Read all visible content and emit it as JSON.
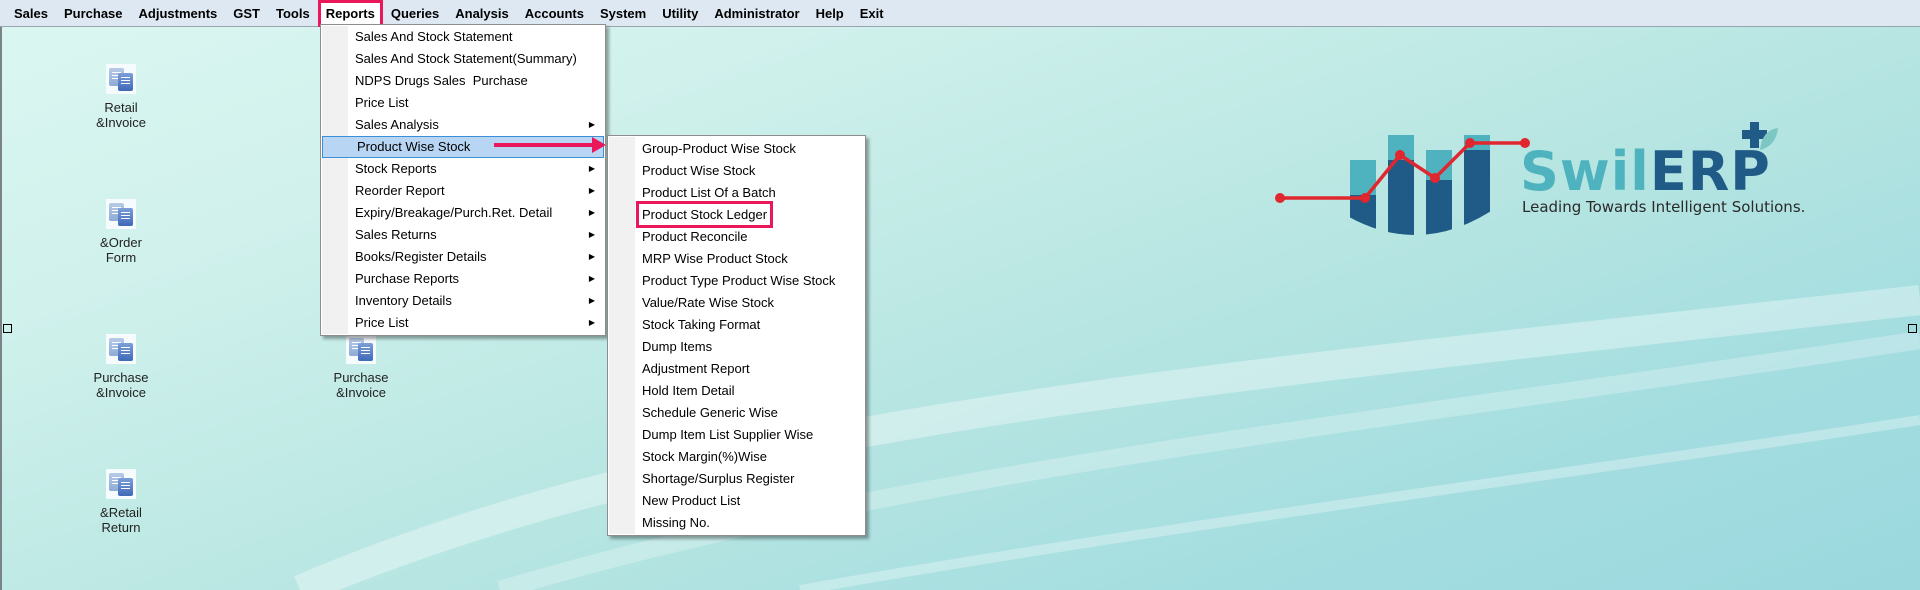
{
  "menubar": {
    "items": [
      "Sales",
      "Purchase",
      "Adjustments",
      "GST",
      "Tools",
      "Reports",
      "Queries",
      "Analysis",
      "Accounts",
      "System",
      "Utility",
      "Administrator",
      "Help",
      "Exit"
    ],
    "active": "Reports"
  },
  "desktop_icons": [
    {
      "line1": "Retail",
      "line2": "&Invoice",
      "icon": "documents-icon"
    },
    {
      "line1": "&Order",
      "line2": "Form",
      "icon": "documents-icon"
    },
    {
      "line1": "Purchase",
      "line2": "&Invoice",
      "icon": "documents-icon"
    },
    {
      "line1": "Purchase",
      "line2": "&Invoice",
      "icon": "documents-icon"
    },
    {
      "line1": "&Retail",
      "line2": "Return",
      "icon": "documents-icon"
    }
  ],
  "reports_menu": {
    "items": [
      {
        "label": "Sales And Stock Statement",
        "submenu": false
      },
      {
        "label": "Sales And Stock Statement(Summary)",
        "submenu": false
      },
      {
        "label": "NDPS Drugs Sales  Purchase",
        "submenu": false
      },
      {
        "label": "Price List",
        "submenu": false
      },
      {
        "label": "Sales Analysis",
        "submenu": true
      },
      {
        "label": "Product Wise Stock",
        "submenu": true,
        "highlighted": true
      },
      {
        "label": "Stock Reports",
        "submenu": true
      },
      {
        "label": "Reorder Report",
        "submenu": true
      },
      {
        "label": "Expiry/Breakage/Purch.Ret. Detail",
        "submenu": true
      },
      {
        "label": "Sales Returns",
        "submenu": true
      },
      {
        "label": "Books/Register Details",
        "submenu": true
      },
      {
        "label": "Purchase Reports",
        "submenu": true
      },
      {
        "label": "Inventory Details",
        "submenu": true
      },
      {
        "label": "Price List",
        "submenu": true
      }
    ]
  },
  "product_wise_stock_submenu": {
    "items": [
      "Group-Product Wise Stock",
      "Product Wise Stock",
      "Product List Of a Batch",
      "Product Stock Ledger",
      "Product Reconcile",
      "MRP Wise Product Stock",
      "Product Type Product Wise Stock",
      "Value/Rate Wise Stock",
      "Stock Taking Format",
      "Dump Items",
      "Adjustment Report",
      "Hold Item Detail",
      "Schedule Generic Wise",
      "Dump Item List Supplier Wise",
      "Stock Margin(%)Wise",
      "Shortage/Surplus Register",
      "New Product List",
      "Missing No."
    ],
    "boxed": "Product Stock Ledger"
  },
  "logo": {
    "word_part1": "Swil",
    "word_part2": "ERP",
    "tagline": "Leading Towards Intelligent Solutions."
  },
  "colors": {
    "accent_annotation": "#e8185a",
    "menu_highlight": "#b8d6f3",
    "logo_teal": "#4fb3bf",
    "logo_navy": "#1f5b86",
    "logo_red": "#e0262e"
  },
  "submenu_arrow_glyph": "▶"
}
